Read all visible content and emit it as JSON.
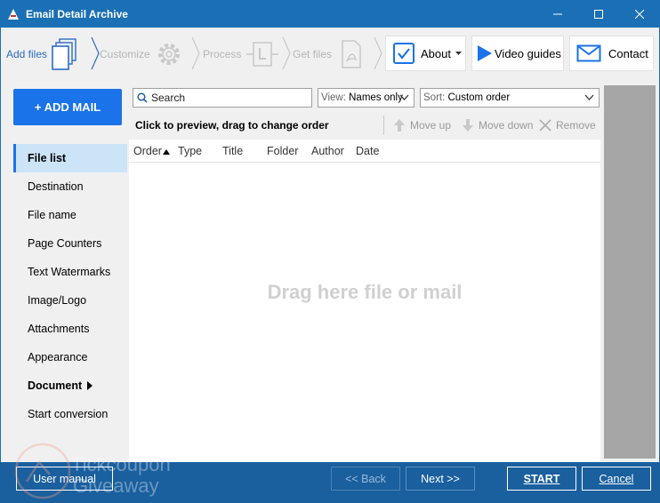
{
  "window": {
    "title": "Email Detail Archive",
    "controls": [
      "minimize",
      "maximize",
      "close"
    ]
  },
  "wizard": {
    "steps": [
      {
        "label": "Add files",
        "icon": "files-icon",
        "active": true
      },
      {
        "label": "Customize",
        "icon": "gear-icon",
        "active": false
      },
      {
        "label": "Process",
        "icon": "process-icon",
        "active": false
      },
      {
        "label": "Get files",
        "icon": "pdf-icon",
        "active": false
      }
    ]
  },
  "toolbar": {
    "about_label": "About",
    "video_label": "Video guides",
    "contact_label": "Contact"
  },
  "sidebar": {
    "add_mail_label": "+ ADD MAIL",
    "items": [
      {
        "label": "File list",
        "selected": true
      },
      {
        "label": "Destination"
      },
      {
        "label": "File name"
      },
      {
        "label": "Page Counters"
      },
      {
        "label": "Text Watermarks"
      },
      {
        "label": "Image/Logo"
      },
      {
        "label": "Attachments"
      },
      {
        "label": "Appearance"
      },
      {
        "label": "Document",
        "bold": true,
        "submenu": true
      },
      {
        "label": "Start conversion"
      }
    ]
  },
  "filters": {
    "search_placeholder": "Search",
    "view_key": "View:",
    "view_value": "Names only",
    "sort_key": "Sort:",
    "sort_value": "Custom order"
  },
  "actions": {
    "hint": "Click to preview, drag to change order",
    "move_up": "Move up",
    "move_down": "Move down",
    "remove": "Remove"
  },
  "columns": [
    "Order",
    "Type",
    "Title",
    "Folder",
    "Author",
    "Date"
  ],
  "dropzone_text": "Drag here file or mail",
  "footer": {
    "manual": "User manual",
    "back": "<< Back",
    "next": "Next >>",
    "start": "START",
    "cancel": "Cancel"
  },
  "watermark_text": [
    "Tickcoupon",
    "Giveaway"
  ],
  "colors": {
    "accent": "#1a73e8",
    "titlebar": "#1a6fb5",
    "footer": "#1a5f9e"
  }
}
